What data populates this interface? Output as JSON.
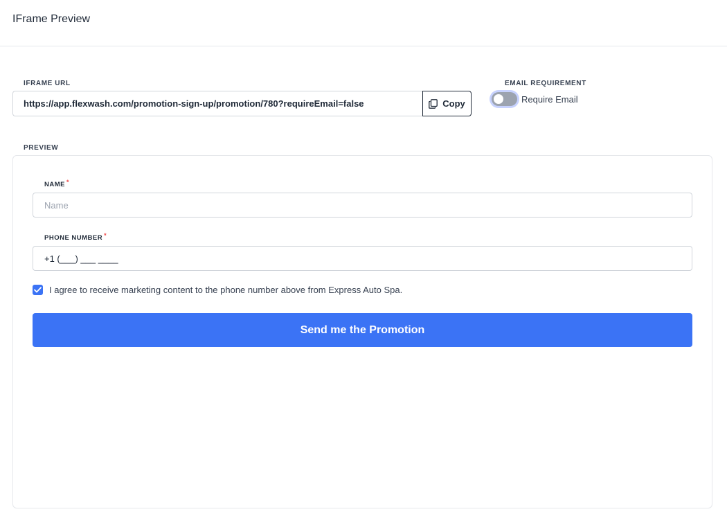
{
  "header": {
    "title": "IFrame Preview"
  },
  "iframe_url": {
    "label": "IFRAME URL",
    "value": "https://app.flexwash.com/promotion-sign-up/promotion/780?requireEmail=false",
    "copy_label": "Copy"
  },
  "email_requirement": {
    "label": "EMAIL REQUIREMENT",
    "toggle_label": "Require Email",
    "enabled": false
  },
  "preview": {
    "label": "PREVIEW",
    "name_field": {
      "label": "NAME",
      "required_mark": "*",
      "placeholder": "Name",
      "value": ""
    },
    "phone_field": {
      "label": "PHONE NUMBER",
      "required_mark": "*",
      "value": "+1 (___) ___ ____"
    },
    "consent": {
      "checked": true,
      "text": "I agree to receive marketing content to the phone number above from Express Auto Spa."
    },
    "submit_label": "Send me the Promotion"
  },
  "colors": {
    "accent": "#3b73f5",
    "required": "#ef4444",
    "toggle_off": "#9ca3af"
  }
}
